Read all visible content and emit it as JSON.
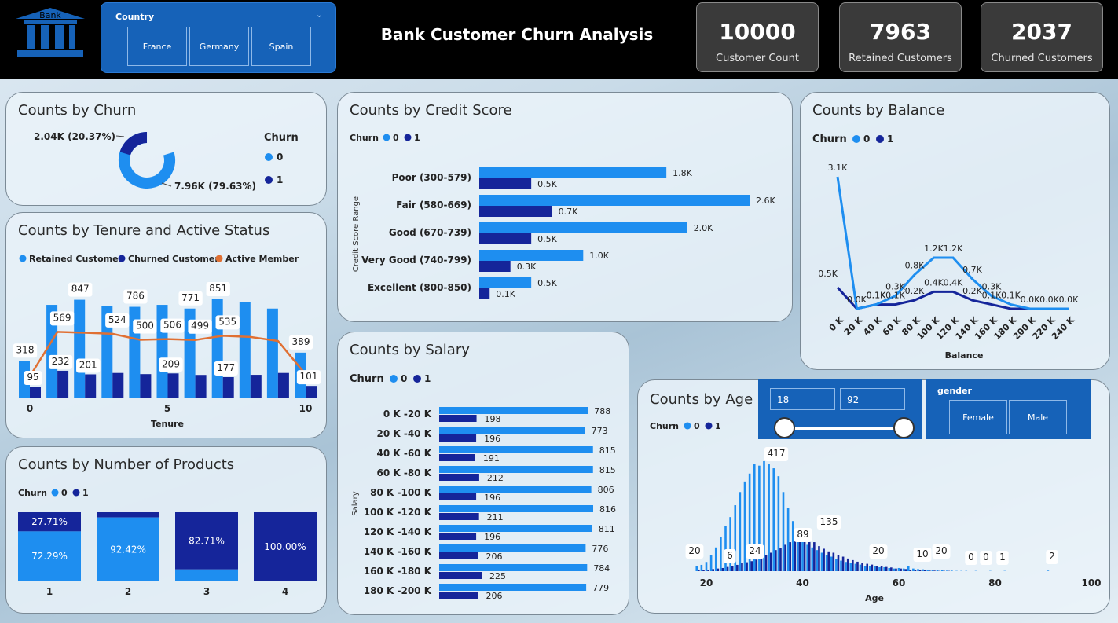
{
  "header": {
    "logo_text": "Bank",
    "title": "Bank Customer Churn Analysis",
    "country_slicer": {
      "label": "Country",
      "options": [
        "France",
        "Germany",
        "Spain"
      ]
    },
    "kpis": [
      {
        "value": "10000",
        "caption": "Customer Count"
      },
      {
        "value": "7963",
        "caption": "Retained Customers"
      },
      {
        "value": "2037",
        "caption": "Churned Customers"
      }
    ]
  },
  "colors": {
    "retained": "#1e8ef0",
    "churned": "#15259a",
    "active": "#e07033"
  },
  "churn_card": {
    "title": "Counts by Churn",
    "legend_title": "Churn",
    "legend": [
      "0",
      "1"
    ],
    "label_churned": "2.04K (20.37%)",
    "label_retained": "7.96K (79.63%)"
  },
  "tenure_card": {
    "title": "Counts by Tenure and Active Status",
    "legend": [
      "Retained Customer",
      "Churned Customer",
      "Active Member"
    ],
    "xlabel": "Tenure",
    "ticks": [
      "0",
      "5",
      "10"
    ]
  },
  "products_card": {
    "title": "Counts by Number of Products",
    "legend_title": "Churn",
    "legend": [
      "0",
      "1"
    ]
  },
  "credit_card": {
    "title": "Counts by Credit Score",
    "legend_title": "Churn",
    "legend": [
      "0",
      "1"
    ],
    "ylabel": "Credit Score Range"
  },
  "salary_card": {
    "title": "Counts by Salary",
    "legend_title": "Churn",
    "legend": [
      "0",
      "1"
    ],
    "ylabel": "Salary"
  },
  "balance_card": {
    "title": "Counts by Balance",
    "legend_title": "Churn",
    "legend": [
      "0",
      "1"
    ],
    "xlabel": "Balance"
  },
  "age_card": {
    "title": "Counts by Age",
    "legend_title": "Churn",
    "legend": [
      "0",
      "1"
    ],
    "xlabel": "Age",
    "ticks": [
      "20",
      "40",
      "60",
      "80",
      "100"
    ],
    "range_min": "18",
    "range_max": "92",
    "gender_label": "gender",
    "gender_options": [
      "Female",
      "Male"
    ]
  },
  "chart_data": [
    {
      "id": "churn",
      "type": "pie",
      "title": "Counts by Churn",
      "categories": [
        "0",
        "1"
      ],
      "values": [
        7963,
        2037
      ],
      "labels": [
        "7.96K (79.63%)",
        "2.04K (20.37%)"
      ]
    },
    {
      "id": "tenure",
      "type": "bar",
      "title": "Counts by Tenure and Active Status",
      "x": [
        0,
        1,
        2,
        3,
        4,
        5,
        6,
        7,
        8,
        9,
        10
      ],
      "series": [
        {
          "name": "Retained Customer",
          "values": [
            318,
            803,
            847,
            796,
            786,
            803,
            771,
            851,
            828,
            771,
            389
          ]
        },
        {
          "name": "Churned Customer",
          "values": [
            95,
            232,
            201,
            213,
            203,
            209,
            196,
            177,
            197,
            213,
            101
          ]
        },
        {
          "name": "Active Member",
          "values": [
            183,
            569,
            562,
            552,
            500,
            506,
            499,
            535,
            525,
            490,
            201
          ]
        }
      ],
      "data_labels": {
        "Retained Customer": {
          "0": "318",
          "2": "847",
          "4": "786",
          "6": "771",
          "7": "851",
          "10": "389"
        },
        "Churned Customer": {
          "0": "95",
          "1": "232",
          "2": "201",
          "5": "209",
          "7": "177",
          "10": "101"
        },
        "Active Member": {
          "1": "569",
          "3": "524",
          "4": "500",
          "5": "506",
          "6": "499",
          "7": "535"
        }
      },
      "xlabel": "Tenure",
      "ylim": [
        0,
        950
      ]
    },
    {
      "id": "products",
      "type": "bar",
      "title": "Counts by Number of Products",
      "categories": [
        "1",
        "2",
        "3",
        "4"
      ],
      "series": [
        {
          "name": "0",
          "values": [
            72.29,
            92.42,
            17.29,
            0
          ]
        },
        {
          "name": "1",
          "values": [
            27.71,
            7.58,
            82.71,
            100
          ]
        }
      ],
      "labels": [
        "27.71%",
        "72.29%",
        "92.42%",
        "82.71%",
        "100.00%"
      ]
    },
    {
      "id": "credit",
      "type": "bar",
      "title": "Counts by Credit Score",
      "ylabel": "Credit Score Range",
      "categories": [
        "Poor (300-579)",
        "Fair (580-669)",
        "Good (670-739)",
        "Very Good (740-799)",
        "Excellent (800-850)"
      ],
      "series": [
        {
          "name": "0",
          "values": [
            1.8,
            2.6,
            2.0,
            1.0,
            0.5
          ],
          "labels": [
            "1.8K",
            "2.6K",
            "2.0K",
            "1.0K",
            "0.5K"
          ]
        },
        {
          "name": "1",
          "values": [
            0.5,
            0.7,
            0.5,
            0.3,
            0.1
          ],
          "labels": [
            "0.5K",
            "0.7K",
            "0.5K",
            "0.3K",
            "0.1K"
          ]
        }
      ]
    },
    {
      "id": "salary",
      "type": "bar",
      "title": "Counts by Salary",
      "ylabel": "Salary",
      "categories": [
        "0 K -20 K",
        "20 K -40 K",
        "40 K -60 K",
        "60 K -80 K",
        "80 K -100 K",
        "100 K -120 K",
        "120 K -140 K",
        "140 K -160 K",
        "160 K -180 K",
        "180 K -200 K"
      ],
      "series": [
        {
          "name": "0",
          "values": [
            788,
            773,
            815,
            815,
            806,
            816,
            811,
            776,
            784,
            779
          ]
        },
        {
          "name": "1",
          "values": [
            198,
            196,
            191,
            212,
            196,
            211,
            196,
            206,
            225,
            206
          ]
        }
      ]
    },
    {
      "id": "balance",
      "type": "line",
      "title": "Counts by Balance",
      "xlabel": "Balance",
      "categories": [
        "0 K",
        "20 K",
        "40 K",
        "60 K",
        "80 K",
        "100 K",
        "120 K",
        "140 K",
        "160 K",
        "180 K",
        "200 K",
        "220 K",
        "240 K"
      ],
      "series": [
        {
          "name": "0",
          "values": [
            3.1,
            0.0,
            0.1,
            0.3,
            0.8,
            1.2,
            1.2,
            0.7,
            0.3,
            0.1,
            0.0,
            0.0,
            0.0
          ],
          "labels": [
            "3.1K",
            "0.0K",
            "0.1K",
            "0.3K",
            "0.8K",
            "1.2K",
            "1.2K",
            "0.7K",
            "0.3K",
            "0.1K",
            "0.0K",
            "0.0K",
            "0.0K"
          ]
        },
        {
          "name": "1",
          "values": [
            0.5,
            0.0,
            0.1,
            0.1,
            0.2,
            0.4,
            0.4,
            0.2,
            0.1,
            0.0,
            0.0,
            0.0,
            0.0
          ],
          "labels": [
            "0.5K",
            "",
            "0.1K",
            "0.1K",
            "0.2K",
            "0.4K",
            "0.4K",
            "0.2K",
            "0.1K",
            "",
            "",
            "",
            ""
          ]
        }
      ]
    },
    {
      "id": "age",
      "type": "bar",
      "title": "Counts by Age",
      "xlabel": "Age",
      "x_range": [
        18,
        92
      ],
      "xlim": [
        20,
        100
      ],
      "ylim": [
        0,
        430
      ],
      "series": [
        {
          "name": "0",
          "values": [
            20,
            24,
            35,
            60,
            90,
            130,
            170,
            205,
            250,
            300,
            340,
            370,
            405,
            400,
            417,
            405,
            390,
            360,
            300,
            240,
            190,
            150,
            120,
            100,
            90,
            80,
            70,
            60,
            55,
            45,
            40,
            35,
            30,
            28,
            25,
            20,
            20,
            18,
            15,
            15,
            12,
            10,
            12,
            10,
            20,
            10,
            8,
            7,
            6,
            5,
            4,
            3,
            2,
            2,
            1,
            1,
            1,
            0,
            1,
            0,
            0,
            1,
            0,
            0,
            1,
            0,
            0,
            0,
            0,
            0,
            0,
            0,
            0,
            2,
            0
          ]
        },
        {
          "name": "1",
          "values": [
            6,
            4,
            5,
            8,
            10,
            12,
            16,
            20,
            24,
            30,
            34,
            38,
            44,
            50,
            60,
            70,
            80,
            89,
            100,
            110,
            120,
            130,
            135,
            125,
            110,
            95,
            85,
            75,
            70,
            62,
            55,
            48,
            42,
            36,
            30,
            28,
            25,
            20,
            20,
            16,
            14,
            10,
            10,
            8,
            6,
            5,
            4,
            3,
            2,
            2,
            1,
            1,
            1,
            0,
            0,
            0,
            0,
            0,
            0,
            0,
            0,
            0,
            0,
            0,
            0,
            0,
            0,
            0,
            0,
            0,
            0,
            0,
            0,
            0,
            0
          ]
        }
      ],
      "data_labels": [
        "20",
        "6",
        "24",
        "417",
        "89",
        "135",
        "20",
        "10",
        "20",
        "0",
        "0",
        "1",
        "2"
      ]
    }
  ]
}
